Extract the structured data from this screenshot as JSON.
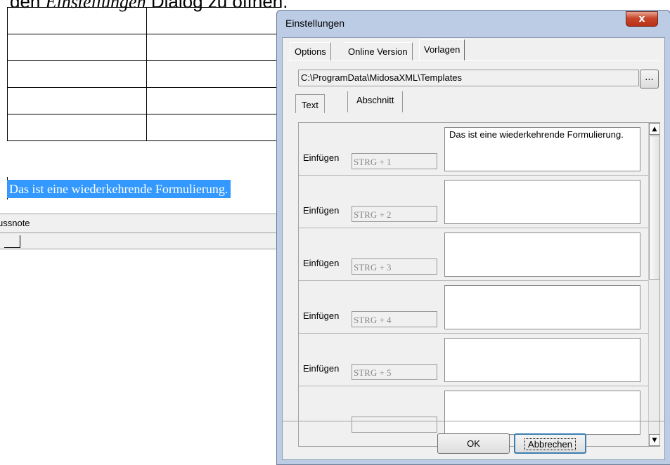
{
  "document": {
    "heading_prefix": "den ",
    "heading_italic": "Einstellungen",
    "heading_suffix": " Dialog zu öffnen.",
    "selected_text": "Das ist eine wiederkehrende Formulierung.",
    "footnote_label": "ussnote"
  },
  "dialog": {
    "title": "Einstellungen",
    "close_glyph": "x",
    "tabs": [
      "Options",
      "Online Version",
      "Vorlagen"
    ],
    "active_tab": "Vorlagen",
    "template_path": "C:\\ProgramData\\MidosaXML\\Templates",
    "browse_label": "...",
    "subtabs": [
      "Text",
      "Abschnitt"
    ],
    "active_subtab": "Text",
    "rows": [
      {
        "label": "Einfügen",
        "shortcut": "STRG + 1",
        "text": "Das ist eine wiederkehrende Formulierung."
      },
      {
        "label": "Einfügen",
        "shortcut": "STRG + 2",
        "text": ""
      },
      {
        "label": "Einfügen",
        "shortcut": "STRG + 3",
        "text": ""
      },
      {
        "label": "Einfügen",
        "shortcut": "STRG + 4",
        "text": ""
      },
      {
        "label": "Einfügen",
        "shortcut": "STRG + 5",
        "text": ""
      },
      {
        "label": "",
        "shortcut": "",
        "text": ""
      }
    ],
    "ok_label": "OK",
    "cancel_label": "Abbrechen"
  },
  "icons": {
    "scroll_up": "▲",
    "scroll_down": "▼"
  }
}
